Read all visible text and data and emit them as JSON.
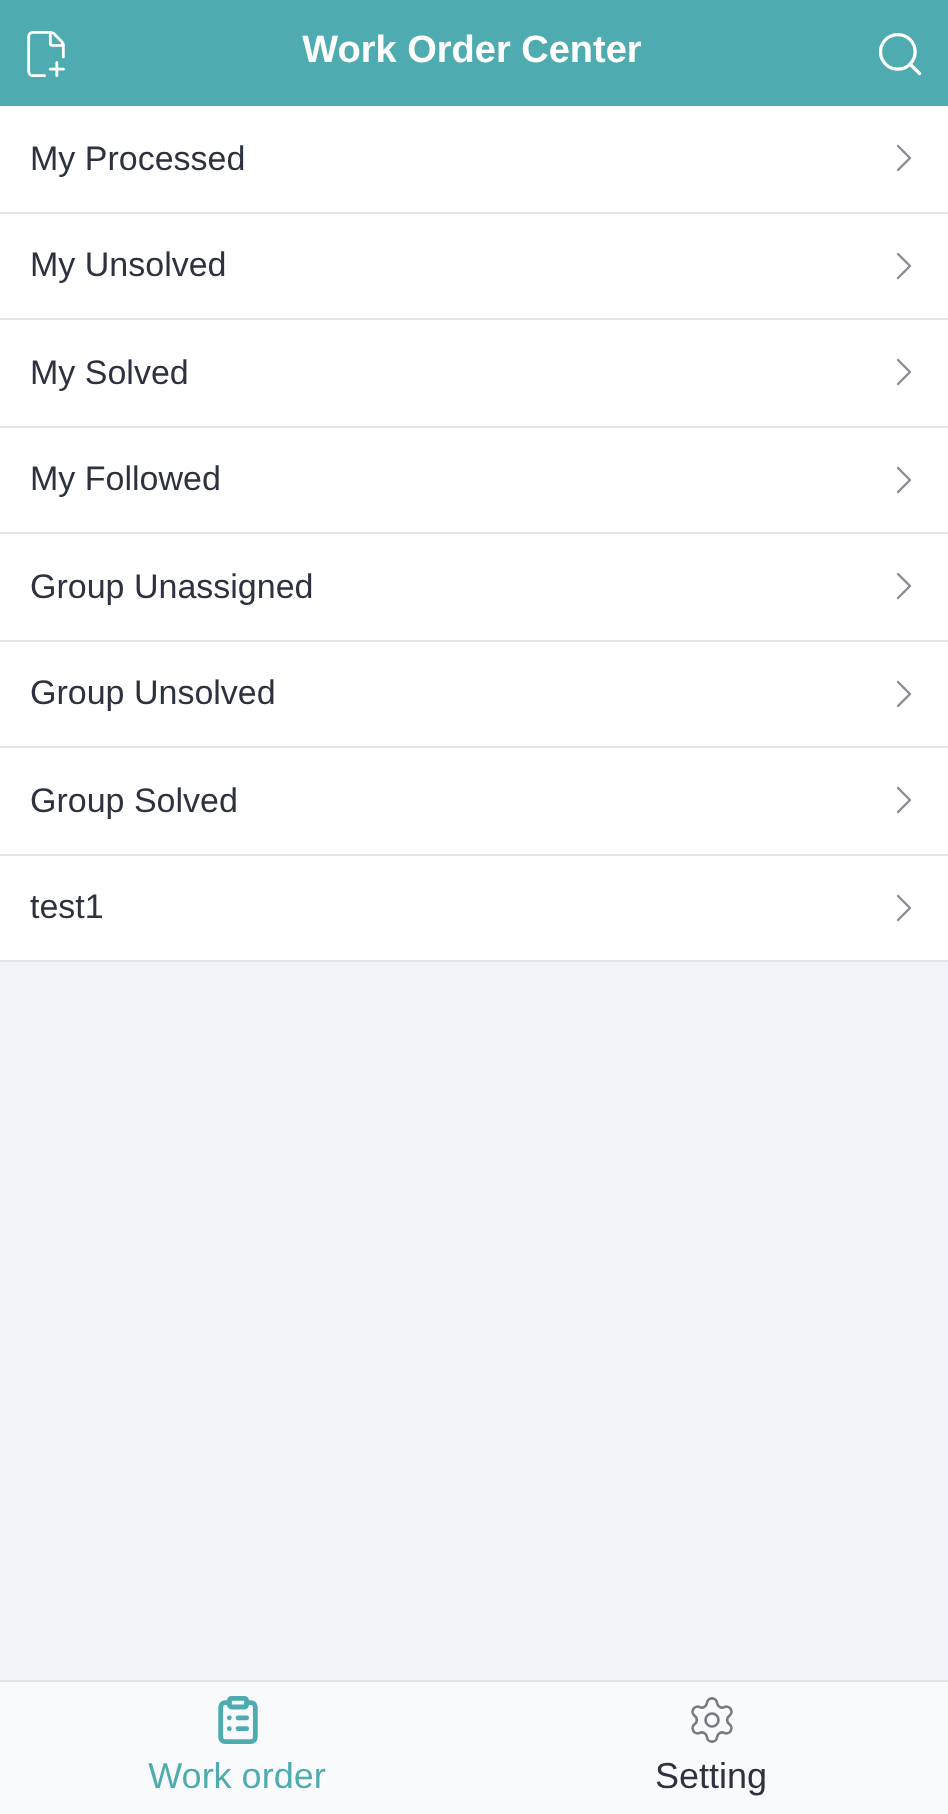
{
  "header": {
    "title": "Work Order Center"
  },
  "items": [
    {
      "label": "My Processed"
    },
    {
      "label": "My Unsolved"
    },
    {
      "label": "My Solved"
    },
    {
      "label": "My Followed"
    },
    {
      "label": "Group Unassigned"
    },
    {
      "label": "Group Unsolved"
    },
    {
      "label": "Group Solved"
    },
    {
      "label": "test1"
    }
  ],
  "tabs": [
    {
      "label": "Work order",
      "kind": "clipboard",
      "selected": true
    },
    {
      "label": "Setting",
      "kind": "gear",
      "selected": false
    }
  ]
}
